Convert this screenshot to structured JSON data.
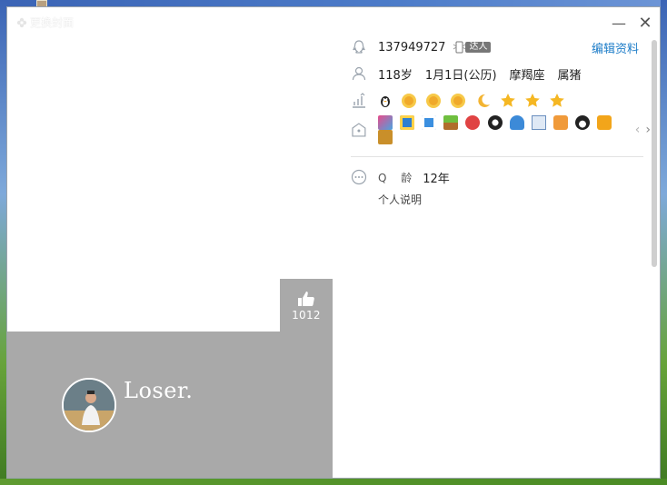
{
  "window": {
    "title": "更换封面",
    "minimize_label": "—",
    "close_label": "✕"
  },
  "cover": {
    "like_count": "1012",
    "nickname": "Loser."
  },
  "profile": {
    "qq_number": "137949727",
    "daren_badge": "达人",
    "edit_label": "编辑资料",
    "age": "118岁",
    "birthday": "1月1日(公历)",
    "zodiac": "摩羯座",
    "chinese_zodiac": "属猪",
    "qq_age_label": "Q 龄",
    "qq_age_value": "12年",
    "personal_note_label": "个人说明"
  },
  "level_icons": [
    "penguin-icon",
    "sun-icon",
    "sun-icon",
    "sun-icon",
    "moon-icon",
    "star-icon",
    "star-icon",
    "star-icon"
  ],
  "service_icons": [
    "qq-music-icon",
    "qq-show-icon",
    "qq-game-icon",
    "qq-farm-icon",
    "qq-pet-icon",
    "qq-ranch-icon",
    "qq-security-icon",
    "qq-mail-icon",
    "qq-video-icon",
    "qq-penguin-icon",
    "qq-vip-icon",
    "qq-reading-icon"
  ],
  "colors": {
    "link": "#1e7dc8",
    "cover_grey": "#a9a9a9"
  }
}
